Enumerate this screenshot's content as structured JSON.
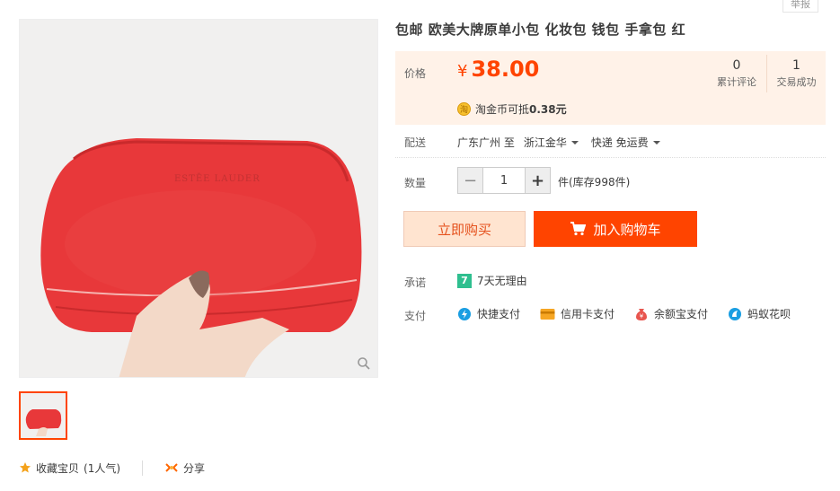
{
  "report_label": "举报",
  "product": {
    "title": "包邮 欧美大牌原单小包 化妆包 钱包 手拿包 红",
    "image_brand_text": "ESTĒE LAUDER"
  },
  "price": {
    "label": "价格",
    "symbol": "¥",
    "amount": "38.00",
    "coin_text": "淘金币可抵",
    "coin_amount": "0.38元"
  },
  "stats": [
    {
      "count": "0",
      "label": "累计评论"
    },
    {
      "count": "1",
      "label": "交易成功"
    }
  ],
  "delivery": {
    "label": "配送",
    "from": "广东广州 至",
    "to": "浙江金华",
    "method": "快递 免运费"
  },
  "quantity": {
    "label": "数量",
    "value": "1",
    "stock": "件(库存998件)",
    "minus": "−",
    "plus": "+"
  },
  "buttons": {
    "buy_now": "立即购买",
    "add_cart": "加入购物车"
  },
  "promise": {
    "label": "承诺",
    "badge": "7",
    "text": "7天无理由"
  },
  "payment": {
    "label": "支付",
    "methods": [
      {
        "label": "快捷支付",
        "icon": "quick-pay-icon",
        "color": "#1a9ee2"
      },
      {
        "label": "信用卡支付",
        "icon": "credit-card-icon",
        "color": "#f6a623"
      },
      {
        "label": "余额宝支付",
        "icon": "yuebao-icon",
        "color": "#e8554e"
      },
      {
        "label": "蚂蚁花呗",
        "icon": "huabei-icon",
        "color": "#1a9ee2"
      }
    ]
  },
  "social": {
    "favorite": "收藏宝贝",
    "favorite_count": "(1人气)",
    "share": "分享"
  },
  "colors": {
    "accent": "#ff4400",
    "price_bg": "#fff2e8",
    "bag_red": "#e8383a"
  }
}
